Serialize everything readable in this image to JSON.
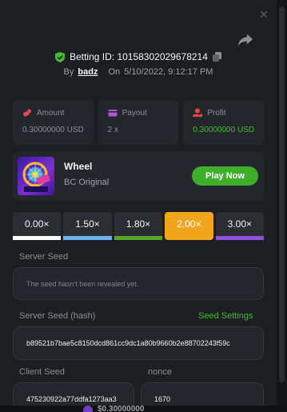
{
  "header": {
    "bet_id_label": "Betting ID: 10158302029678214",
    "by_label": "By",
    "user": "badz",
    "on_label": "On",
    "timestamp": "5/10/2022, 9:12:17 PM"
  },
  "stats": [
    {
      "label": "Amount",
      "value": "0.30000000 USD",
      "icon": "coins-icon",
      "color": "#e0455a"
    },
    {
      "label": "Payout",
      "value": "2 x",
      "icon": "wallet-icon",
      "color": "#b057e0"
    },
    {
      "label": "Profit",
      "value": "0.30000000 USD",
      "icon": "money-hand-icon",
      "color": "#e34a3d"
    }
  ],
  "game": {
    "name": "Wheel",
    "provider": "BC Original",
    "play_label": "Play Now"
  },
  "multipliers": [
    {
      "label": "0.00×",
      "color": "#ffffff",
      "active": false
    },
    {
      "label": "1.50×",
      "color": "#69b6f0",
      "active": false
    },
    {
      "label": "1.80×",
      "color": "#59a928",
      "active": false
    },
    {
      "label": "2.00×",
      "color": "#f1a51d",
      "active": true
    },
    {
      "label": "3.00×",
      "color": "#9151e0",
      "active": false
    }
  ],
  "seeds": {
    "server_seed_label": "Server Seed",
    "server_seed_value": "The seed hasn't been revealed yet.",
    "server_hash_label": "Server Seed (hash)",
    "seed_settings_label": "Seed Settings",
    "server_hash_value": "b89521b7bae5c8150dcd861cc9dc1a80b9660b2e88702243f59c",
    "client_seed_label": "Client Seed",
    "client_seed_value": "475230922a77ddfa1273aa3",
    "nonce_label": "nonce",
    "nonce_value": "1670"
  },
  "footer": {
    "amount": "$0.30000000"
  },
  "colors": {
    "accent_green": "#3fae2a",
    "active_orange": "#f1a51d",
    "panel": "#24262b",
    "background": "#1c1e22"
  }
}
